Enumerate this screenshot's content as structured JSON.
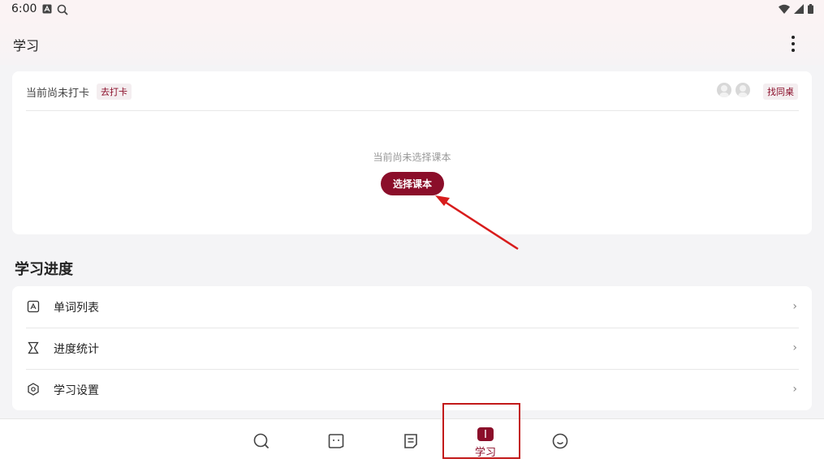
{
  "status_bar": {
    "time": "6:00"
  },
  "app_bar": {
    "title": "学习"
  },
  "checkin": {
    "status_text": "当前尚未打卡",
    "checkin_tag": "去打卡",
    "find_desk_tag": "找同桌"
  },
  "book": {
    "empty_text": "当前尚未选择课本",
    "choose_button": "选择课本"
  },
  "progress": {
    "section_title": "学习进度",
    "items": [
      {
        "label": "单词列表",
        "icon": "word-list-icon"
      },
      {
        "label": "进度统计",
        "icon": "hourglass-icon"
      },
      {
        "label": "学习设置",
        "icon": "settings-hexagon-icon"
      }
    ]
  },
  "bottom_nav": {
    "items": [
      {
        "icon": "search-icon"
      },
      {
        "icon": "chat-icon"
      },
      {
        "icon": "notes-icon"
      },
      {
        "icon": "book-icon",
        "label": "学习",
        "active": true
      },
      {
        "icon": "smiley-icon"
      }
    ]
  },
  "colors": {
    "accent": "#8b0e2a",
    "annotation": "#c21a1a"
  }
}
